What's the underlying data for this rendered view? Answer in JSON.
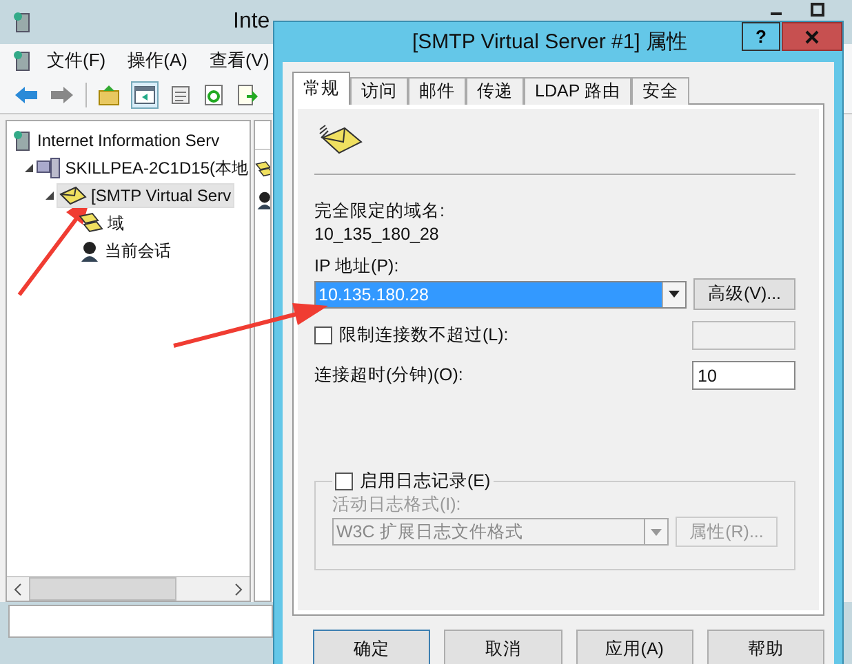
{
  "main_window": {
    "title": "Inte",
    "menu": [
      "文件(F)",
      "操作(A)",
      "查看(V)"
    ],
    "tree": [
      {
        "label": "Internet Information Serv",
        "kind": "server",
        "selected": false,
        "children": [
          {
            "label": "SKILLPEA-2C1D15(本地",
            "kind": "computer",
            "expanded": true,
            "selected": false,
            "children": [
              {
                "label": "[SMTP Virtual Serv",
                "kind": "mail",
                "expanded": true,
                "selected": true,
                "children": [
                  {
                    "label": "域",
                    "kind": "domain",
                    "selected": false
                  },
                  {
                    "label": "当前会话",
                    "kind": "user",
                    "selected": false
                  }
                ]
              }
            ]
          }
        ]
      }
    ]
  },
  "dialog": {
    "title": "[SMTP Virtual Server #1] 属性",
    "help": "?",
    "tabs": [
      {
        "label": "常规",
        "selected": true
      },
      {
        "label": "访问",
        "selected": false
      },
      {
        "label": "邮件",
        "selected": false
      },
      {
        "label": "传递",
        "selected": false
      },
      {
        "label": "LDAP 路由",
        "selected": false
      },
      {
        "label": "安全",
        "selected": false
      }
    ],
    "fqdn_label": "完全限定的域名:",
    "fqdn_value": "10_135_180_28",
    "ip_label": "IP 地址(P):",
    "ip_value": "10.135.180.28",
    "ip_highlighted": true,
    "advanced_button": "高级(V)...",
    "limit_connections": {
      "label": "限制连接数不超过(L):",
      "checked": false
    },
    "timeout_label": "连接超时(分钟)(O):",
    "timeout_value": "10",
    "logging": {
      "label": "启用日志记录(E)",
      "checked": false,
      "format_label": "活动日志格式(I):",
      "format_value": "W3C 扩展日志文件格式",
      "properties_button": "属性(R)...",
      "disabled": true
    },
    "buttons": [
      {
        "label": "确定",
        "default": true
      },
      {
        "label": "取消",
        "default": false
      },
      {
        "label": "应用(A)",
        "default": false
      },
      {
        "label": "帮助",
        "default": false
      }
    ]
  }
}
